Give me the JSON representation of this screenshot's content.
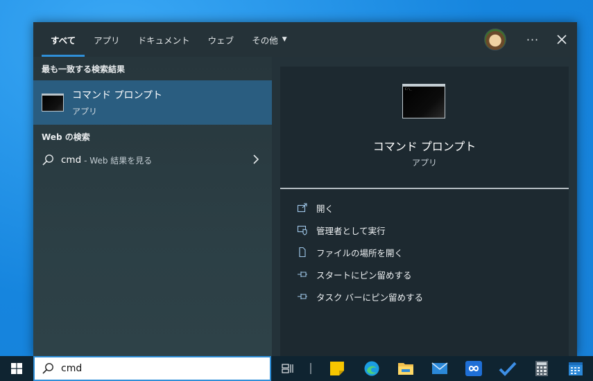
{
  "tabs": [
    {
      "label": "すべて",
      "active": true
    },
    {
      "label": "アプリ"
    },
    {
      "label": "ドキュメント"
    },
    {
      "label": "ウェブ"
    },
    {
      "label": "その他",
      "dropdown": true
    }
  ],
  "header_icons": {
    "avatar": "user-avatar",
    "more": "···",
    "close": "close-icon"
  },
  "left": {
    "best_match_header": "最も一致する検索結果",
    "best_match": {
      "title": "コマンド プロンプト",
      "subtitle": "アプリ",
      "icon": "cmd-icon"
    },
    "web_header": "Web の検索",
    "web_item": {
      "query": "cmd",
      "suffix": "- Web 結果を見る"
    }
  },
  "preview": {
    "title": "コマンド プロンプト",
    "subtitle": "アプリ",
    "icon": "cmd-icon"
  },
  "actions": [
    {
      "label": "開く",
      "icon": "open-icon"
    },
    {
      "label": "管理者として実行",
      "icon": "run-as-admin-icon"
    },
    {
      "label": "ファイルの場所を開く",
      "icon": "file-location-icon"
    },
    {
      "label": "スタートにピン留めする",
      "icon": "pin-icon"
    },
    {
      "label": "タスク バーにピン留めする",
      "icon": "pin-icon"
    }
  ],
  "taskbar": {
    "search_value": "cmd",
    "apps": [
      "task-view-icon",
      "sticky-notes-icon",
      "edge-icon",
      "file-explorer-icon",
      "mail-icon",
      "infinity-app-icon",
      "todo-icon",
      "calculator-icon",
      "calendar-icon"
    ]
  },
  "colors": {
    "accent": "#2f8fd8",
    "highlight": "#2a5d80",
    "panel": "#243239",
    "taskbar": "#0f2431"
  }
}
